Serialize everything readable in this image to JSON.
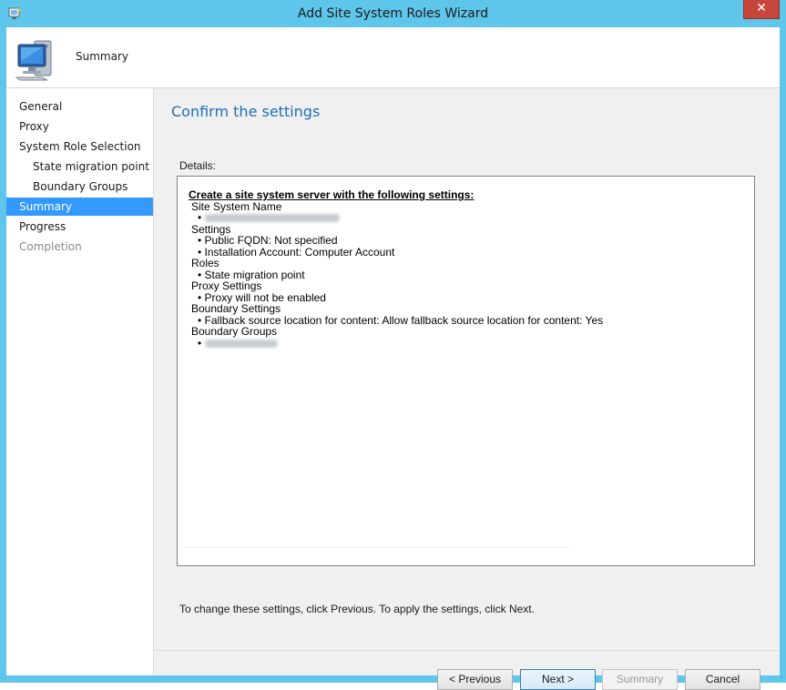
{
  "window": {
    "title": "Add Site System Roles Wizard",
    "close_label": "✕"
  },
  "header": {
    "title": "Summary"
  },
  "nav": {
    "items": [
      {
        "label": "General"
      },
      {
        "label": "Proxy"
      },
      {
        "label": "System Role Selection"
      },
      {
        "label": "State migration point"
      },
      {
        "label": "Boundary Groups"
      },
      {
        "label": "Summary"
      },
      {
        "label": "Progress"
      },
      {
        "label": "Completion"
      }
    ]
  },
  "main": {
    "title": "Confirm the settings",
    "details_label": "Details:",
    "details": {
      "heading": "Create a site system server with the following settings:",
      "site_system_name_label": "Site System Name",
      "settings_label": "Settings",
      "settings_items": [
        "Public FQDN: Not specified",
        "Installation Account: Computer Account"
      ],
      "roles_label": "Roles",
      "roles_items": [
        "State migration point"
      ],
      "proxy_label": "Proxy Settings",
      "proxy_items": [
        "Proxy will not be enabled"
      ],
      "boundary_settings_label": "Boundary Settings",
      "boundary_settings_items": [
        "Fallback source location for content: Allow fallback source location for content: Yes"
      ],
      "boundary_groups_label": "Boundary Groups",
      "bullet": "•"
    },
    "hint": "To change these settings, click Previous. To apply the settings, click Next."
  },
  "buttons": {
    "previous": "< Previous",
    "next": "Next >",
    "summary": "Summary",
    "cancel": "Cancel"
  },
  "colors": {
    "accent": "#3399ff",
    "title_blue": "#1e6ebe",
    "frame": "#5fc6eb",
    "close": "#c7463b"
  }
}
